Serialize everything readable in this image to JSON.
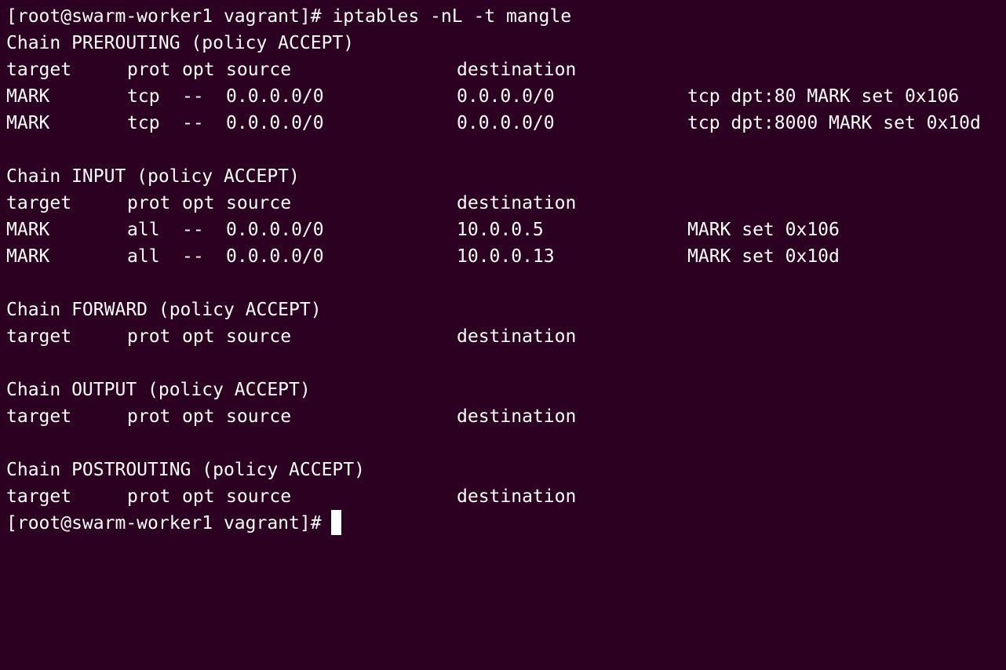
{
  "terminal": {
    "prompt": "[root@swarm-worker1 vagrant]#",
    "command": "iptables -nL -t mangle",
    "background_color": "#2c0021",
    "text_color": "#ffffff"
  },
  "header_row": {
    "target": "target",
    "prot": "prot",
    "opt": "opt",
    "source": "source",
    "destination": "destination"
  },
  "chains": [
    {
      "title": "Chain PREROUTING (policy ACCEPT)",
      "rules": [
        {
          "target": "MARK",
          "prot": "tcp",
          "opt": "--",
          "source": "0.0.0.0/0",
          "destination": "0.0.0.0/0",
          "extra": "tcp dpt:80 MARK set 0x106"
        },
        {
          "target": "MARK",
          "prot": "tcp",
          "opt": "--",
          "source": "0.0.0.0/0",
          "destination": "0.0.0.0/0",
          "extra": "tcp dpt:8000 MARK set 0x10d"
        }
      ]
    },
    {
      "title": "Chain INPUT (policy ACCEPT)",
      "rules": [
        {
          "target": "MARK",
          "prot": "all",
          "opt": "--",
          "source": "0.0.0.0/0",
          "destination": "10.0.0.5",
          "extra": "MARK set 0x106"
        },
        {
          "target": "MARK",
          "prot": "all",
          "opt": "--",
          "source": "0.0.0.0/0",
          "destination": "10.0.0.13",
          "extra": "MARK set 0x10d"
        }
      ]
    },
    {
      "title": "Chain FORWARD (policy ACCEPT)",
      "rules": []
    },
    {
      "title": "Chain OUTPUT (policy ACCEPT)",
      "rules": []
    },
    {
      "title": "Chain POSTROUTING (policy ACCEPT)",
      "rules": []
    }
  ],
  "final_prompt": "[root@swarm-worker1 vagrant]#"
}
